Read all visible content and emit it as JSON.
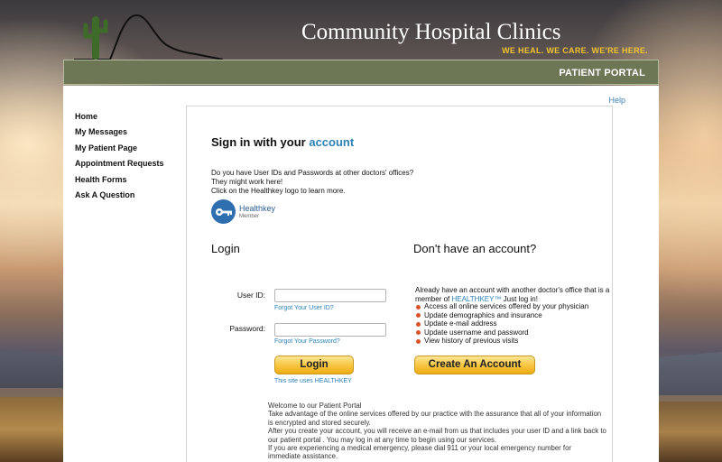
{
  "header": {
    "hospital_name": "Community Hospital Clinics",
    "tagline": "WE HEAL. WE CARE. WE'RE HERE.",
    "portal_title": "PATIENT PORTAL"
  },
  "help_label": "Help",
  "sidebar": {
    "items": [
      {
        "label": "Home"
      },
      {
        "label": "My Messages"
      },
      {
        "label": "My Patient Page"
      },
      {
        "label": "Appointment Requests"
      },
      {
        "label": "Health Forms"
      },
      {
        "label": "Ask A Question"
      }
    ]
  },
  "signin": {
    "title_prefix": "Sign in with your",
    "title_accent": "account",
    "intro_lines": [
      "Do you have User IDs and Passwords at other doctors' offices?",
      "They might work here!",
      "Click on the Healthkey logo to learn more."
    ],
    "healthkey_name": "Healthkey",
    "healthkey_sub": "Member"
  },
  "login": {
    "heading": "Login",
    "userid_label": "User ID:",
    "userid_value": "",
    "forgot_userid": "Forgot Your User ID?",
    "password_label": "Password:",
    "password_value": "",
    "forgot_password": "Forgot Your Password?",
    "button_label": "Login",
    "healthkey_note": "This site uses HEALTHKEY"
  },
  "no_account": {
    "heading": "Don't have an account?",
    "text_line1": "Already have an account with another doctor's office that is a",
    "text_line2_prefix": "member of ",
    "text_line2_link": "HEALTHKEY™",
    "text_line2_suffix": " Just log in!",
    "bullets": [
      "Access all online services offered by your physician",
      "Update demographics and insurance",
      "Update e-mail address",
      "Update username and password",
      "View history of previous visits"
    ],
    "button_label": "Create An Account"
  },
  "welcome": {
    "lines": [
      "Welcome to our Patient Portal",
      "Take advantage of the online services offered by our practice with the assurance that all of your information",
      "is encrypted and stored securely.",
      "After you create your account, you will receive an e-mail from us that includes your user ID and a link back to",
      "our patient portal . You may log in at any time to begin using our services.",
      "If you are experiencing a medical emergency, please dial 911 or your local emergency number for",
      "immediate assistance."
    ]
  },
  "colors": {
    "accent": "#2c82b5",
    "header_bar": "#6d7655",
    "tagline": "#f1c232",
    "bullet": "#d9522b",
    "button_gold": "#f9c94a"
  },
  "icons": {
    "healthkey_logo": "key-circle-icon",
    "header_art": "cactus-mountain-icon"
  }
}
